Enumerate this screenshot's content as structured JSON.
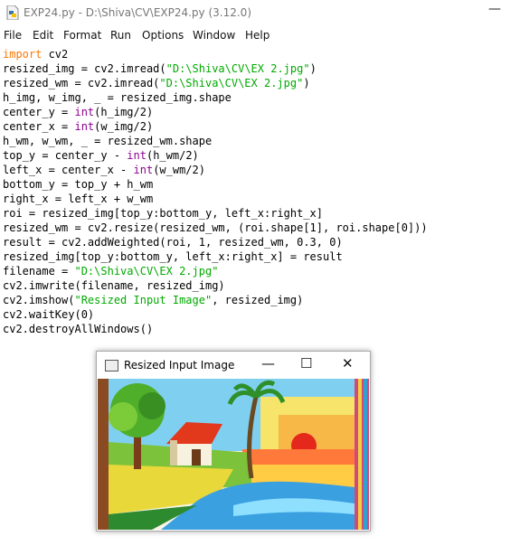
{
  "window": {
    "title": "EXP24.py - D:\\Shiva\\CV\\EXP24.py (3.12.0)",
    "minimize_glyph": "—"
  },
  "menu": [
    "File",
    "Edit",
    "Format",
    "Run",
    "Options",
    "Window",
    "Help"
  ],
  "code_lines": [
    [
      {
        "t": "import",
        "c": "kw"
      },
      {
        "t": " cv2"
      }
    ],
    [
      {
        "t": "resized_img = cv2.imread("
      },
      {
        "t": "\"D:\\Shiva\\CV\\EX 2.jpg\"",
        "c": "st"
      },
      {
        "t": ")"
      }
    ],
    [
      {
        "t": "resized_wm = cv2.imread("
      },
      {
        "t": "\"D:\\Shiva\\CV\\EX 2.jpg\"",
        "c": "st"
      },
      {
        "t": ")"
      }
    ],
    [
      {
        "t": "h_img, w_img, _ = resized_img.shape"
      }
    ],
    [
      {
        "t": "center_y = "
      },
      {
        "t": "int",
        "c": "bi"
      },
      {
        "t": "(h_img/2)"
      }
    ],
    [
      {
        "t": "center_x = "
      },
      {
        "t": "int",
        "c": "bi"
      },
      {
        "t": "(w_img/2)"
      }
    ],
    [
      {
        "t": "h_wm, w_wm, _ = resized_wm.shape"
      }
    ],
    [
      {
        "t": "top_y = center_y - "
      },
      {
        "t": "int",
        "c": "bi"
      },
      {
        "t": "(h_wm/2)"
      }
    ],
    [
      {
        "t": "left_x = center_x - "
      },
      {
        "t": "int",
        "c": "bi"
      },
      {
        "t": "(w_wm/2)"
      }
    ],
    [
      {
        "t": "bottom_y = top_y + h_wm"
      }
    ],
    [
      {
        "t": "right_x = left_x + w_wm"
      }
    ],
    [
      {
        "t": "roi = resized_img[top_y:bottom_y, left_x:right_x]"
      }
    ],
    [
      {
        "t": "resized_wm = cv2.resize(resized_wm, (roi.shape[1], roi.shape[0]))"
      }
    ],
    [
      {
        "t": "result = cv2.addWeighted(roi, 1, resized_wm, 0.3, 0)"
      }
    ],
    [
      {
        "t": "resized_img[top_y:bottom_y, left_x:right_x] = result"
      }
    ],
    [
      {
        "t": "filename = "
      },
      {
        "t": "\"D:\\Shiva\\CV\\EX 2.jpg\"",
        "c": "st"
      }
    ],
    [
      {
        "t": "cv2.imwrite(filename, resized_img)"
      }
    ],
    [
      {
        "t": "cv2.imshow("
      },
      {
        "t": "\"Resized Input Image\"",
        "c": "st"
      },
      {
        "t": ", resized_img)"
      }
    ],
    [
      {
        "t": "cv2.waitKey(0)"
      }
    ],
    [
      {
        "t": "cv2.destroyAllWindows()"
      }
    ]
  ],
  "image_window": {
    "title": "Resized Input Image",
    "minimize_glyph": "—",
    "maximize_glyph": "☐",
    "close_glyph": "✕"
  }
}
